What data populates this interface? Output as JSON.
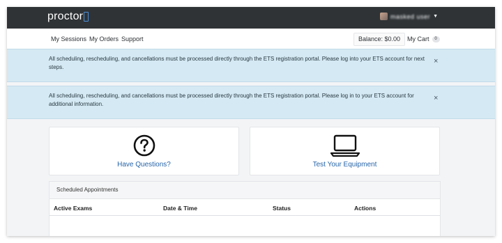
{
  "header": {
    "logo_text": "proctor",
    "user_name": "masked user"
  },
  "nav": {
    "links": [
      "My Sessions",
      "My Orders",
      "Support"
    ],
    "balance": "Balance: $0.00",
    "cart_label": "My Cart",
    "cart_count": "0"
  },
  "alerts": [
    {
      "text": "All scheduling, rescheduling, and cancellations must be processed directly through the ETS registration portal. Please log into your ETS account for next steps.",
      "close": "×"
    },
    {
      "text": "All scheduling, rescheduling, and cancellations must be processed directly through the ETS registration portal. Please log in to your ETS account for additional information.",
      "close": "×"
    }
  ],
  "cards": [
    {
      "label": "Have Questions?",
      "icon": "question-circle-icon"
    },
    {
      "label": "Test Your Equipment",
      "icon": "laptop-icon"
    }
  ],
  "appointments": {
    "title": "Scheduled Appointments",
    "columns": [
      "Active Exams",
      "Date & Time",
      "Status",
      "Actions"
    ]
  },
  "colors": {
    "topbar": "#2f3336",
    "alert_bg": "#d4e9f3",
    "link_blue": "#2563a8",
    "logo_accent": "#4a90d9"
  }
}
